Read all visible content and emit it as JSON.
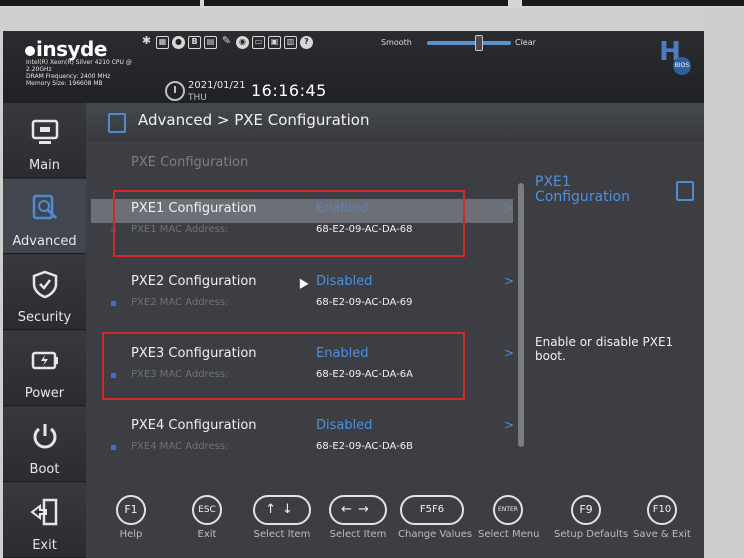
{
  "header": {
    "brand": "insyde",
    "cpu_info": [
      "Intel(R) Xeon(R) Silver 4210 CPU @",
      "2.20GHz",
      "DRAM Frequency: 2400 MHz",
      "Memory Size: 196608 MB"
    ],
    "date": "2021/01/21",
    "day": "THU",
    "time": "16:16:45",
    "smooth_label": "Smooth",
    "clear_label": "Clear",
    "smooth_level": 0.57,
    "h2_badge": "BIOS"
  },
  "sidebar": {
    "items": [
      {
        "label": "Main",
        "icon": "monitor-icon"
      },
      {
        "label": "Advanced",
        "icon": "advanced-icon"
      },
      {
        "label": "Security",
        "icon": "shield-icon"
      },
      {
        "label": "Power",
        "icon": "battery-icon"
      },
      {
        "label": "Boot",
        "icon": "power-icon"
      },
      {
        "label": "Exit",
        "icon": "exit-door-icon"
      }
    ],
    "active": "Advanced"
  },
  "breadcrumb": "Advanced > PXE Configuration",
  "section_header": "PXE Configuration",
  "rows": [
    {
      "name": "PXE1 Configuration",
      "value": "Enabled",
      "sub_label": "PXE1 MAC Address:",
      "mac": "68-E2-09-AC-DA-68"
    },
    {
      "name": "PXE2 Configuration",
      "value": "Disabled",
      "sub_label": "PXE2 MAC Address:",
      "mac": "68-E2-09-AC-DA-69"
    },
    {
      "name": "PXE3 Configuration",
      "value": "Enabled",
      "sub_label": "PXE3 MAC Address:",
      "mac": "68-E2-09-AC-DA-6A"
    },
    {
      "name": "PXE4 Configuration",
      "value": "Disabled",
      "sub_label": "PXE4 MAC Address:",
      "mac": "68-E2-09-AC-DA-6B"
    }
  ],
  "arrow": ">",
  "help": {
    "title": "PXE1 Configuration",
    "text": "Enable or disable PXE1 boot."
  },
  "footer_keys": [
    {
      "key": "F1",
      "label": "Help"
    },
    {
      "key": "ESC",
      "label": "Exit"
    },
    {
      "key": "↑↓",
      "label": "Select Item"
    },
    {
      "key": "←→",
      "label": "Select Item"
    },
    {
      "key": "F5F6",
      "label": "Change Values"
    },
    {
      "key": "ENTER",
      "label": "Select Menu"
    },
    {
      "key": "F9",
      "label": "Setup Defaults"
    },
    {
      "key": "F10",
      "label": "Save & Exit"
    }
  ],
  "colors": {
    "accent": "#4f8fe0",
    "highlight": "#6c6f75",
    "annotation_red": "#d2282a"
  }
}
